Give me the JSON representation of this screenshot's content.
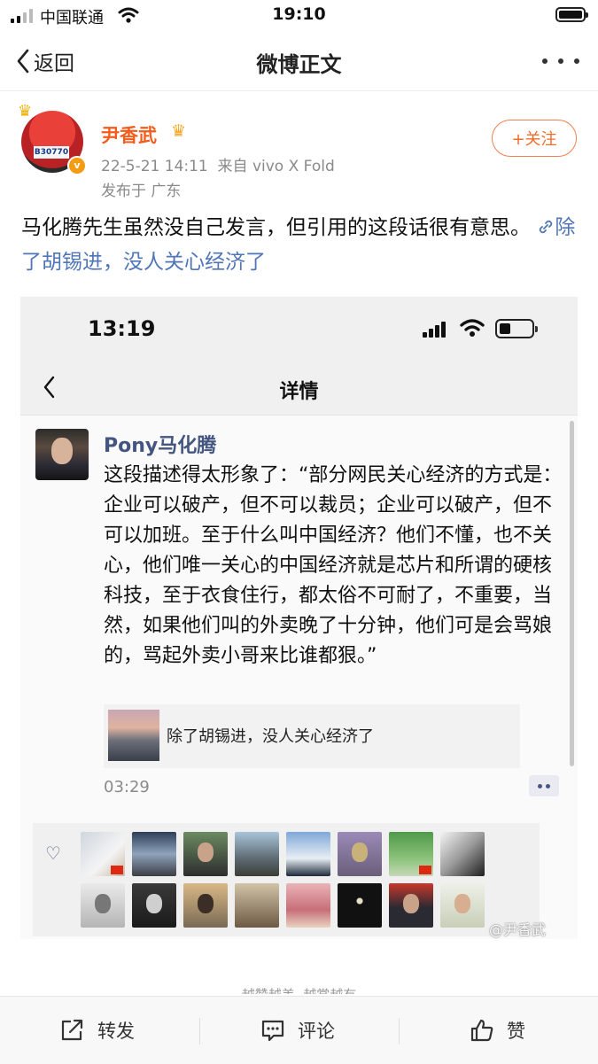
{
  "status_bar": {
    "carrier": "中国联通",
    "time": "19:10"
  },
  "nav": {
    "back_label": "返回",
    "title": "微博正文"
  },
  "post": {
    "username": "尹香武",
    "meta": "22-5-21 14:11  来自 vivo X Fold",
    "location": "发布于 广东",
    "follow_label": "+关注",
    "text": "马化腾先生虽然没自己发言，但引用的这段话很有意思。",
    "link_text": "除了胡锡进，没人关心经济了",
    "avatar_bib": "B30770"
  },
  "embedded": {
    "time": "13:19",
    "title": "详情",
    "author": "Pony马化腾",
    "content": "这段描述得太形象了：“部分网民关心经济的方式是：企业可以破产，但不可以裁员；企业可以破产，但不可以加班。至于什么叫中国经济？他们不懂，也不关心，他们唯一关心的中国经济就是芯片和所谓的硬核科技，至于衣食住行，都太俗不可耐了，不重要，当然，如果他们叫的外卖晚了十分钟，他们可是会骂娘的，骂起外卖小哥来比谁都狠。”",
    "quote": "除了胡锡进，没人关心经济了",
    "post_time": "03:29"
  },
  "watermark": "@尹香武",
  "cutoff_text": "越赞越美  越赏越有",
  "bottom_bar": {
    "repost": "转发",
    "comment": "评论",
    "like": "赞"
  },
  "colors": {
    "username": "#f35c1d",
    "link": "#5076b8",
    "follow": "#f26b2a",
    "pony_name": "#44557f"
  }
}
